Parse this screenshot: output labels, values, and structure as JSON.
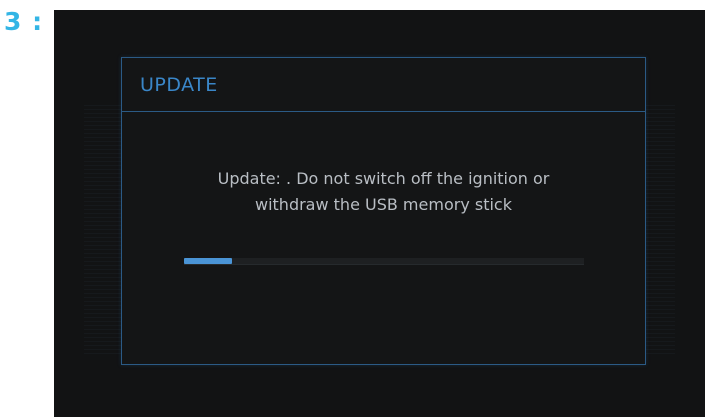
{
  "step": {
    "label": "3 :"
  },
  "dialog": {
    "title": "UPDATE",
    "message_line1": "Update: . Do not switch off the ignition or",
    "message_line2": "withdraw the USB memory stick",
    "progress_fraction": 0.12
  },
  "colors": {
    "accent": "#3a86c8",
    "border": "#2b5a85",
    "progress": "#4a94d6",
    "background": "#121314",
    "step_label": "#33b5e5"
  }
}
